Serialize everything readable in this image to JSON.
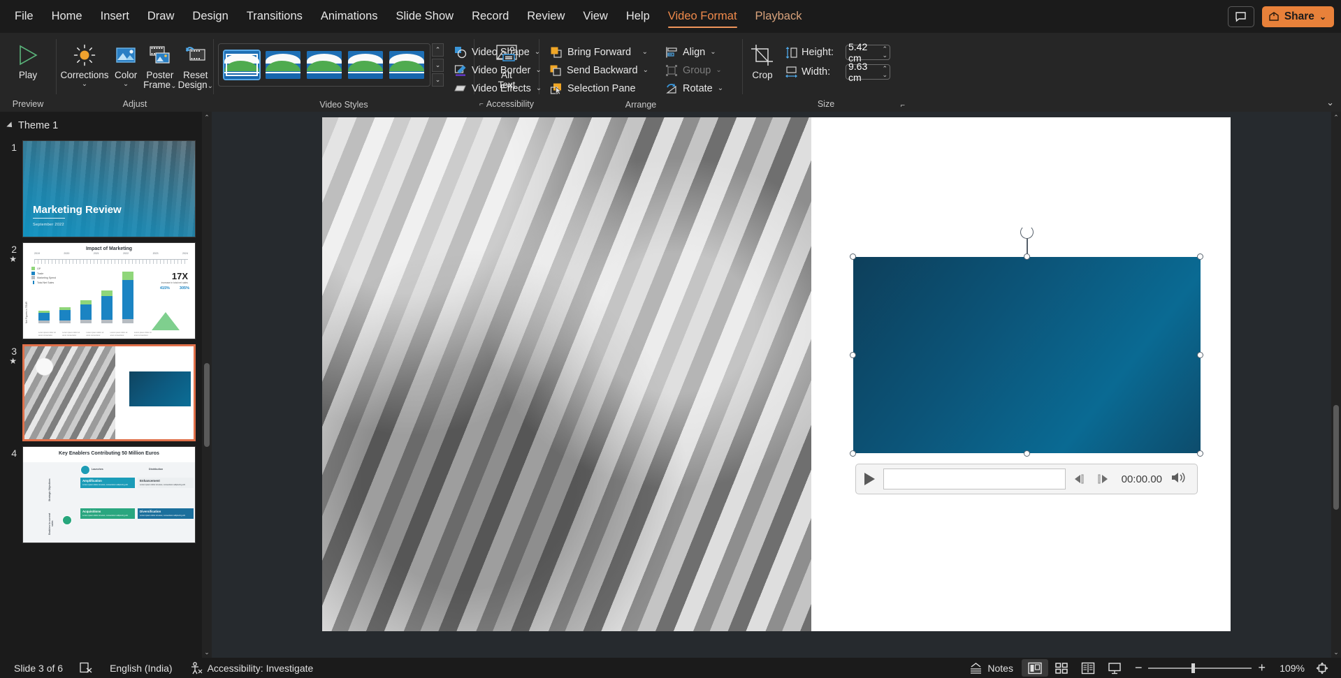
{
  "menu": {
    "items": [
      {
        "label": "File",
        "state": "normal"
      },
      {
        "label": "Home",
        "state": "normal"
      },
      {
        "label": "Insert",
        "state": "normal"
      },
      {
        "label": "Draw",
        "state": "normal"
      },
      {
        "label": "Design",
        "state": "normal"
      },
      {
        "label": "Transitions",
        "state": "normal"
      },
      {
        "label": "Animations",
        "state": "normal"
      },
      {
        "label": "Slide Show",
        "state": "normal"
      },
      {
        "label": "Record",
        "state": "normal"
      },
      {
        "label": "Review",
        "state": "normal"
      },
      {
        "label": "View",
        "state": "normal"
      },
      {
        "label": "Help",
        "state": "normal"
      },
      {
        "label": "Video Format",
        "state": "active"
      },
      {
        "label": "Playback",
        "state": "contextual"
      }
    ],
    "comment_icon": "comment-icon",
    "share_label": "Share",
    "share_icon": "share-icon",
    "share_caret": "⌄"
  },
  "ribbon": {
    "groups": [
      {
        "label": "Preview"
      },
      {
        "label": "Adjust"
      },
      {
        "label": "Video Styles"
      },
      {
        "label": "Accessibility"
      },
      {
        "label": "Arrange"
      },
      {
        "label": "Size"
      }
    ],
    "preview": {
      "play_label": "Play",
      "play_icon": "play-triangle-icon"
    },
    "adjust": {
      "corrections_label": "Corrections",
      "corrections_icon": "brightness-sun-icon",
      "color_label": "Color",
      "color_icon": "picture-color-icon",
      "poster_frame_label_1": "Poster",
      "poster_frame_label_2": "Frame",
      "poster_frame_icon": "film-picture-icon",
      "reset_design_label_1": "Reset",
      "reset_design_label_2": "Design",
      "reset_design_icon": "reset-film-icon",
      "caret": "⌄"
    },
    "video_styles": {
      "gallery_count": 5,
      "selected_index": 0,
      "scroll_up": "⌃",
      "scroll_down": "⌄",
      "scroll_more": "⌄"
    },
    "shape_effects": {
      "items": [
        {
          "label": "Video Shape",
          "icon": "video-shape-icon",
          "caret": "⌄"
        },
        {
          "label": "Video Border",
          "icon": "video-border-pen-icon",
          "caret": "⌄"
        },
        {
          "label": "Video Effects",
          "icon": "video-effects-icon",
          "caret": "⌄"
        }
      ]
    },
    "accessibility": {
      "alt_text_label_1": "Alt",
      "alt_text_label_2": "Text",
      "alt_text_icon": "alt-text-picture-icon",
      "dialog_launcher": "⌐"
    },
    "arrange": {
      "items": [
        {
          "label": "Bring Forward",
          "icon": "bring-forward-icon",
          "caret": "⌄",
          "disabled": false
        },
        {
          "label": "Send Backward",
          "icon": "send-backward-icon",
          "caret": "⌄",
          "disabled": false
        },
        {
          "label": "Selection Pane",
          "icon": "selection-pane-icon",
          "caret": "",
          "disabled": false
        }
      ],
      "items2": [
        {
          "label": "Align",
          "icon": "align-icon",
          "caret": "⌄",
          "disabled": false
        },
        {
          "label": "Group",
          "icon": "group-icon",
          "caret": "⌄",
          "disabled": true
        },
        {
          "label": "Rotate",
          "icon": "rotate-icon",
          "caret": "⌄",
          "disabled": false
        }
      ]
    },
    "size": {
      "crop_label": "Crop",
      "crop_icon": "crop-icon",
      "height_label": "Height:",
      "height_value": "5.42 cm",
      "height_icon": "height-arrows-icon",
      "width_label": "Width:",
      "width_value": "9.63 cm",
      "width_icon": "width-arrows-icon",
      "spin_up": "⌃",
      "spin_down": "⌄",
      "dialog_launcher": "⌐"
    },
    "collapse_ribbon": "⌄"
  },
  "slide_panel": {
    "section_label": "Theme 1",
    "expand_icon": "expand-triangle-icon",
    "slides": [
      {
        "number": "1",
        "marker": "",
        "active": false,
        "kind": "title",
        "title": "Marketing Review",
        "subtitle": "September 2022"
      },
      {
        "number": "2",
        "marker": "★",
        "active": false,
        "kind": "chart",
        "title": "Impact of Marketing",
        "legend": [
          "GP",
          "Trade",
          "Marketing Spend",
          "Total Net Sales"
        ],
        "years": [
          "2019",
          "2020",
          "2021",
          "2022",
          "2023",
          "2024"
        ],
        "big_value": "17X",
        "big_sub": "increase in total net sales",
        "pct_a": "415%",
        "pct_b": "305%",
        "ylabel": "Net Figures in TEUR"
      },
      {
        "number": "3",
        "marker": "★",
        "active": true,
        "kind": "photo-video"
      },
      {
        "number": "4",
        "marker": "",
        "active": false,
        "kind": "table",
        "title": "Key Enablers Contributing 50 Million Euros",
        "col_headers": [
          "Launches",
          "Distribution"
        ],
        "row_labels": [
          "Strategic Objectives",
          "Enablers to current sales"
        ],
        "cells": [
          {
            "h": "Amplification",
            "b": "Lorem ipsum dolor sit amet, consectetur adipiscing elit."
          },
          {
            "h": "Enhancement",
            "b": "Lorem ipsum dolor sit amet, consectetur adipiscing elit."
          },
          {
            "h": "Acquisitions",
            "b": "Lorem ipsum dolor sit amet, consectetur adipiscing elit."
          },
          {
            "h": "Diversification",
            "b": "Lorem ipsum dolor sit amet, consectetur adipiscing elit."
          }
        ]
      }
    ],
    "scroll_up": "⌃",
    "scroll_down": "⌄"
  },
  "canvas": {
    "video_placeholder_name": "video-object",
    "media_bar": {
      "play_icon": "media-play-icon",
      "step_back_icon": "step-backward-icon",
      "step_forward_icon": "step-forward-icon",
      "time": "00:00.00",
      "volume_icon": "volume-icon"
    },
    "scroll_up": "⌃",
    "scroll_down": "⌄"
  },
  "statusbar": {
    "slide_count": "Slide 3 of 6",
    "spellcheck_icon": "spellcheck-icon",
    "language": "English (India)",
    "accessibility_icon": "accessibility-person-icon",
    "accessibility": "Accessibility: Investigate",
    "notes_label": "Notes",
    "notes_icon": "notes-caret-icon",
    "views": [
      {
        "name": "normal-view",
        "icon": "normal-view-icon",
        "active": true
      },
      {
        "name": "slide-sorter-view",
        "icon": "slide-sorter-icon",
        "active": false
      },
      {
        "name": "reading-view",
        "icon": "reading-view-icon",
        "active": false
      },
      {
        "name": "slide-show-view",
        "icon": "slide-show-icon",
        "active": false
      }
    ],
    "zoom_out": "−",
    "zoom_in": "+",
    "zoom_level": "109%",
    "fit_icon": "fit-slide-icon"
  },
  "colors": {
    "accent_orange": "#e8813a",
    "active_tab": "#f08a4b",
    "selection_red": "#e0704a",
    "video_blue": "#0c5478",
    "ribbon_bg": "#262626",
    "chrome_bg": "#1b1b1b",
    "canvas_bg": "#262a2e"
  }
}
